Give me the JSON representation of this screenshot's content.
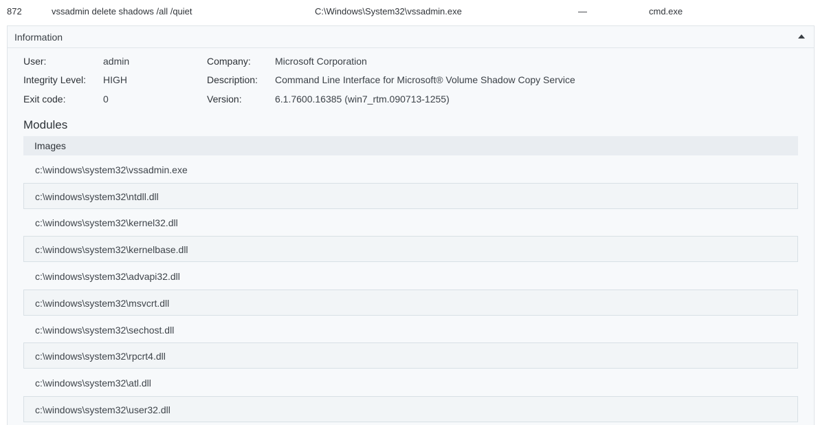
{
  "process": {
    "pid": "872",
    "command": "vssadmin delete shadows /all /quiet",
    "path": "C:\\Windows\\System32\\vssadmin.exe",
    "dash": "—",
    "parent": "cmd.exe"
  },
  "panel": {
    "title": "Information",
    "user_label": "User:",
    "user_value": "admin",
    "integrity_label": "Integrity Level:",
    "integrity_value": "HIGH",
    "exit_label": "Exit code:",
    "exit_value": "0",
    "company_label": "Company:",
    "company_value": "Microsoft Corporation",
    "description_label": "Description:",
    "description_value": "Command Line Interface for Microsoft® Volume Shadow Copy Service",
    "version_label": "Version:",
    "version_value": "6.1.7600.16385 (win7_rtm.090713-1255)"
  },
  "modules": {
    "title": "Modules",
    "header": "Images",
    "images": [
      "c:\\windows\\system32\\vssadmin.exe",
      "c:\\windows\\system32\\ntdll.dll",
      "c:\\windows\\system32\\kernel32.dll",
      "c:\\windows\\system32\\kernelbase.dll",
      "c:\\windows\\system32\\advapi32.dll",
      "c:\\windows\\system32\\msvcrt.dll",
      "c:\\windows\\system32\\sechost.dll",
      "c:\\windows\\system32\\rpcrt4.dll",
      "c:\\windows\\system32\\atl.dll",
      "c:\\windows\\system32\\user32.dll"
    ]
  },
  "icons": {
    "collapse": "caret-up-icon"
  }
}
